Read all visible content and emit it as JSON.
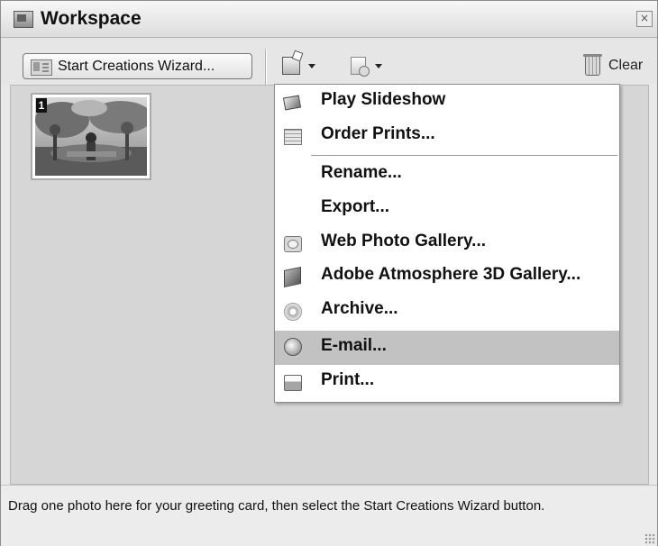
{
  "window": {
    "title": "Workspace"
  },
  "toolbar": {
    "wizard_label": "Start Creations Wizard...",
    "clear_label": "Clear"
  },
  "thumbnail": {
    "number": "1"
  },
  "menu": {
    "items": [
      {
        "label": "Play Slideshow",
        "icon": "slideshow-icon"
      },
      {
        "label": "Order Prints...",
        "icon": "order-prints-icon"
      },
      {
        "label": "Rename...",
        "icon": ""
      },
      {
        "label": "Export...",
        "icon": ""
      },
      {
        "label": "Web Photo Gallery...",
        "icon": "web-gallery-icon"
      },
      {
        "label": "Adobe Atmosphere 3D Gallery...",
        "icon": "3d-gallery-icon"
      },
      {
        "label": "Archive...",
        "icon": "archive-disc-icon"
      },
      {
        "label": "E-mail...",
        "icon": "email-icon",
        "highlighted": true
      },
      {
        "label": "Print...",
        "icon": "printer-icon"
      }
    ]
  },
  "status": {
    "text": "Drag one photo here for your greeting card, then select the Start Creations Wizard button."
  }
}
